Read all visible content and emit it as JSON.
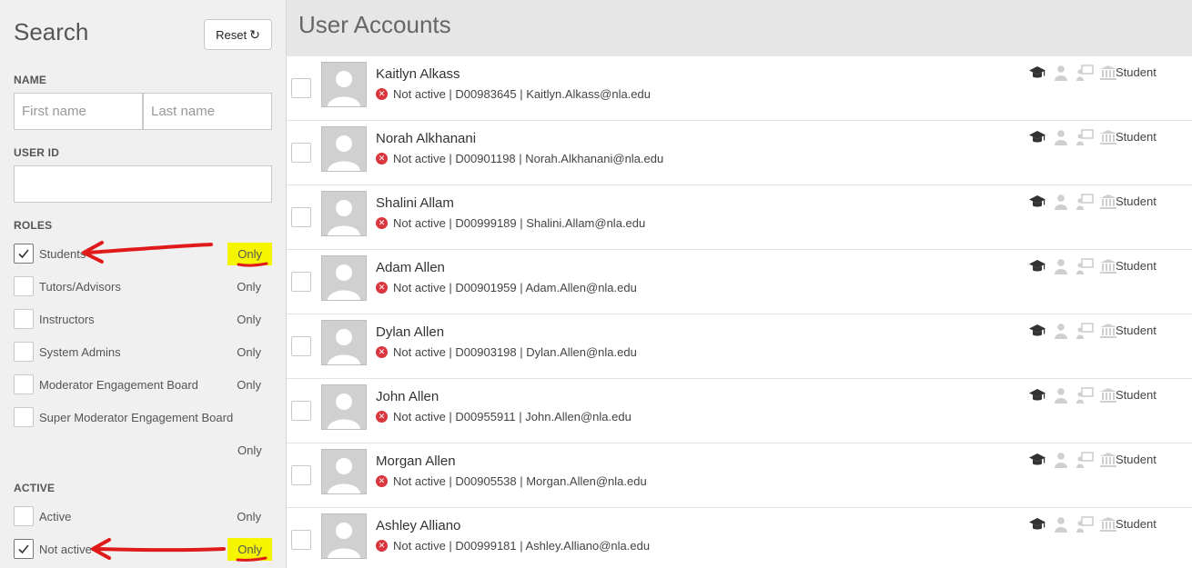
{
  "sidebar": {
    "title": "Search",
    "reset_label": "Reset",
    "name_label": "NAME",
    "first_name_placeholder": "First name",
    "last_name_placeholder": "Last name",
    "userid_label": "USER ID",
    "userid_value": "",
    "roles_label": "ROLES",
    "roles": [
      {
        "label": "Students",
        "checked": true,
        "only": "Only"
      },
      {
        "label": "Tutors/Advisors",
        "checked": false,
        "only": "Only"
      },
      {
        "label": "Instructors",
        "checked": false,
        "only": "Only"
      },
      {
        "label": "System Admins",
        "checked": false,
        "only": "Only"
      },
      {
        "label": "Moderator Engagement Board",
        "checked": false,
        "only": "Only"
      },
      {
        "label": "Super Moderator Engagement Board",
        "checked": false,
        "only": "Only"
      }
    ],
    "active_label": "ACTIVE",
    "active_options": [
      {
        "label": "Active",
        "checked": false,
        "only": "Only"
      },
      {
        "label": "Not active",
        "checked": true,
        "only": "Only"
      }
    ]
  },
  "main": {
    "title": "User Accounts",
    "users": [
      {
        "name": "Kaitlyn Alkass",
        "status": "Not active",
        "id": "D00983645",
        "email": "Kaitlyn.Alkass@nla.edu",
        "role": "Student"
      },
      {
        "name": "Norah Alkhanani",
        "status": "Not active",
        "id": "D00901198",
        "email": "Norah.Alkhanani@nla.edu",
        "role": "Student"
      },
      {
        "name": "Shalini Allam",
        "status": "Not active",
        "id": "D00999189",
        "email": "Shalini.Allam@nla.edu",
        "role": "Student"
      },
      {
        "name": "Adam Allen",
        "status": "Not active",
        "id": "D00901959",
        "email": "Adam.Allen@nla.edu",
        "role": "Student"
      },
      {
        "name": "Dylan Allen",
        "status": "Not active",
        "id": "D00903198",
        "email": "Dylan.Allen@nla.edu",
        "role": "Student"
      },
      {
        "name": "John Allen",
        "status": "Not active",
        "id": "D00955911",
        "email": "John.Allen@nla.edu",
        "role": "Student"
      },
      {
        "name": "Morgan Allen",
        "status": "Not active",
        "id": "D00905538",
        "email": "Morgan.Allen@nla.edu",
        "role": "Student"
      },
      {
        "name": "Ashley Alliano",
        "status": "Not active",
        "id": "D00999181",
        "email": "Ashley.Alliano@nla.edu",
        "role": "Student"
      }
    ]
  },
  "colors": {
    "highlight": "#f5f500",
    "annotation_red": "#e01a1a",
    "status_red": "#d9363e",
    "sidebar_bg": "#f0f0f0",
    "header_bg": "#e6e6e6"
  },
  "icons": [
    "reset-icon",
    "checkmark-icon",
    "not-active-icon",
    "graduation-cap-icon",
    "person-icon",
    "presentation-icon",
    "institution-icon",
    "avatar-placeholder-icon"
  ]
}
